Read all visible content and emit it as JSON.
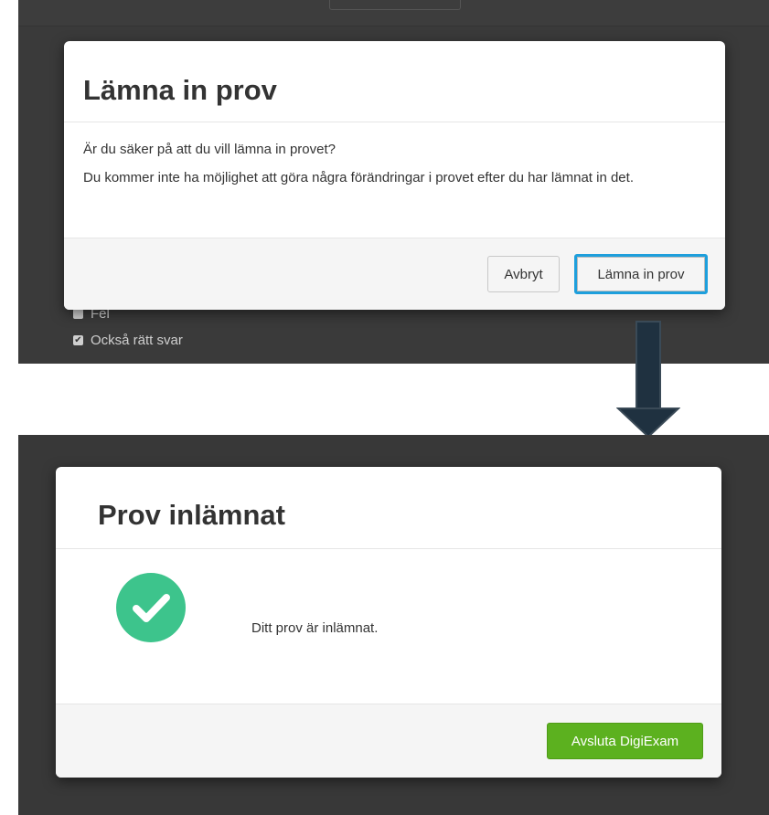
{
  "confirm_dialog": {
    "title": "Lämna in prov",
    "question": "Är du säker på att du vill lämna in provet?",
    "warning": "Du kommer inte ha möjlighet att göra några förändringar i provet efter du har lämnat in det.",
    "cancel_label": "Avbryt",
    "submit_label": "Lämna in prov"
  },
  "background_options": [
    {
      "label": "Fel",
      "checked": false
    },
    {
      "label": "Också rätt svar",
      "checked": true
    }
  ],
  "success_dialog": {
    "title": "Prov inlämnat",
    "message": "Ditt prov är inlämnat.",
    "finish_label": "Avsluta DigiExam"
  },
  "colors": {
    "accent_focus": "#1e9fdc",
    "success_green": "#3dc48c",
    "finish_button": "#5cb11f",
    "arrow_fill": "#1f3140"
  },
  "icons": {
    "success": "checkmark-circle-icon",
    "flow": "arrow-down-icon"
  }
}
